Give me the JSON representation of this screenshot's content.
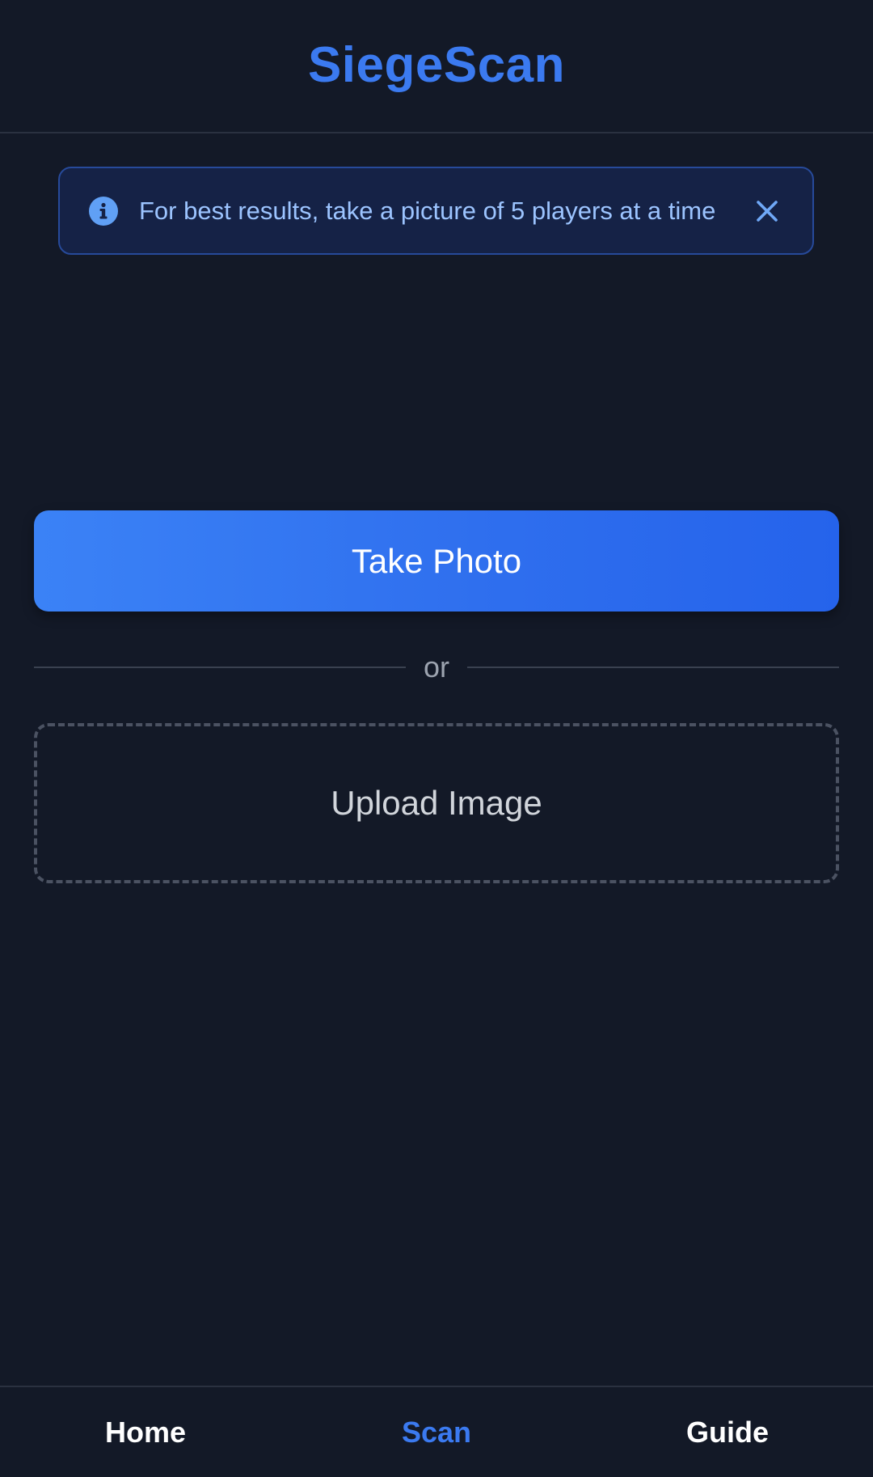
{
  "app": {
    "title": "SiegeScan"
  },
  "banner": {
    "icon": "info-icon",
    "text": "For best results, take a picture of 5 players at a time",
    "close_icon": "close-icon"
  },
  "actions": {
    "take_photo_label": "Take Photo",
    "divider_label": "or",
    "upload_label": "Upload Image"
  },
  "nav": {
    "items": [
      {
        "label": "Home",
        "active": false
      },
      {
        "label": "Scan",
        "active": true
      },
      {
        "label": "Guide",
        "active": false
      }
    ]
  },
  "colors": {
    "background": "#131927",
    "accent": "#3b7af0",
    "banner_bg": "#152246",
    "banner_text": "#9cc4ff"
  }
}
